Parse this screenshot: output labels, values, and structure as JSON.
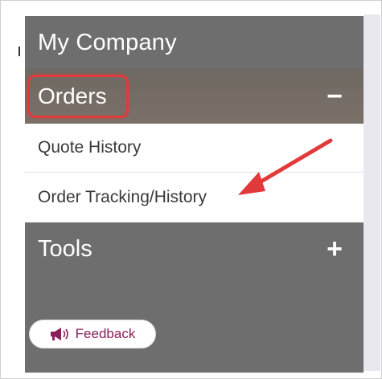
{
  "sidebar": {
    "company_label": "My Company",
    "orders": {
      "label": "Orders",
      "toggle": "−"
    },
    "sub_items": [
      {
        "label": "Quote History"
      },
      {
        "label": "Order Tracking/History"
      }
    ],
    "tools": {
      "label": "Tools",
      "toggle": "+"
    },
    "feedback_label": "Feedback"
  },
  "colors": {
    "sidebar_bg": "#6e6e6e",
    "highlight": "#e23a3a",
    "feedback_text": "#8a1f5c"
  },
  "icons": {
    "feedback": "megaphone-icon",
    "orders_toggle": "minus-icon",
    "tools_toggle": "plus-icon"
  }
}
